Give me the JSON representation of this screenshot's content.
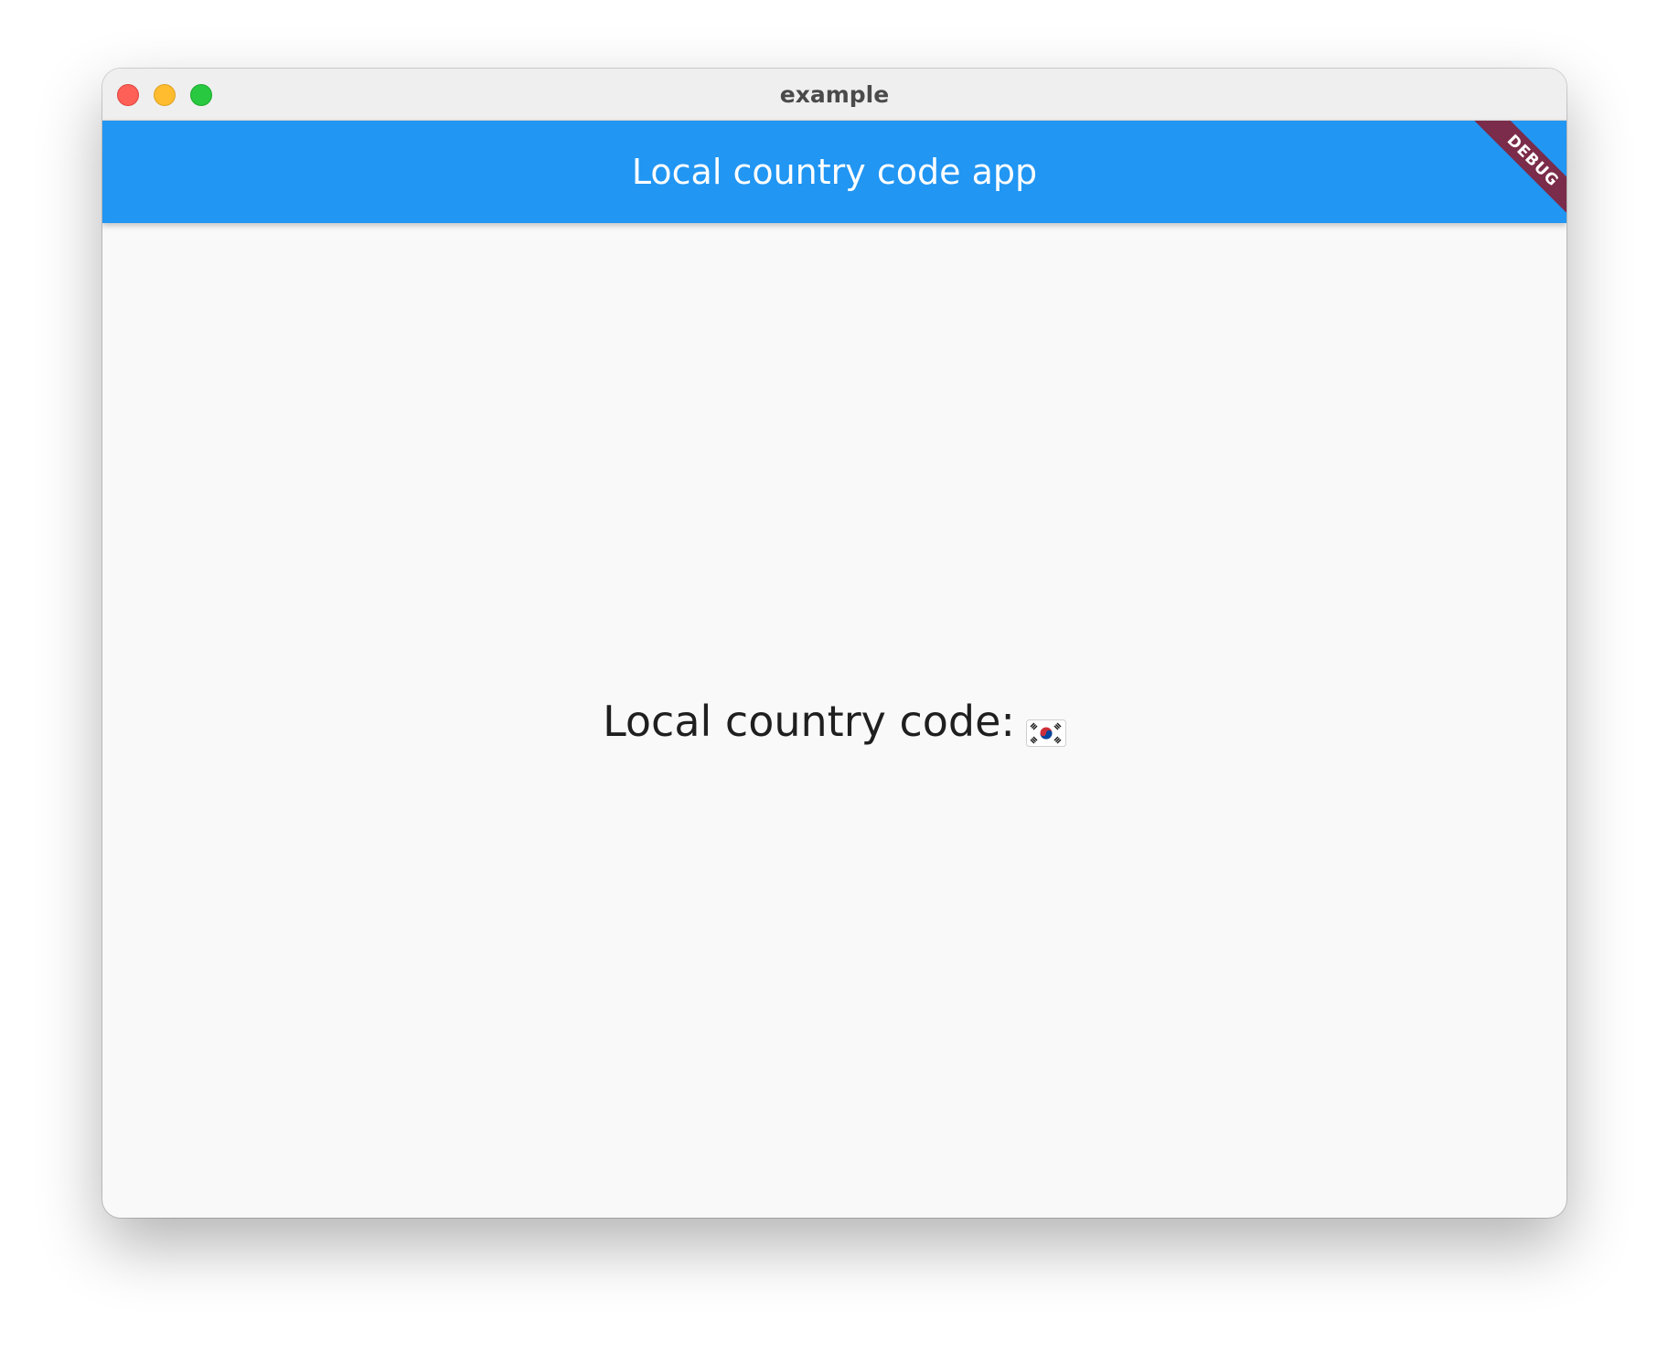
{
  "window": {
    "title": "example"
  },
  "appbar": {
    "title": "Local country code app",
    "color": "#2196f3"
  },
  "debug_banner": {
    "label": "DEBUG",
    "color": "#7b2c4a"
  },
  "main": {
    "label": "Local country code:",
    "country_flag_icon": "south-korea-flag-icon"
  }
}
